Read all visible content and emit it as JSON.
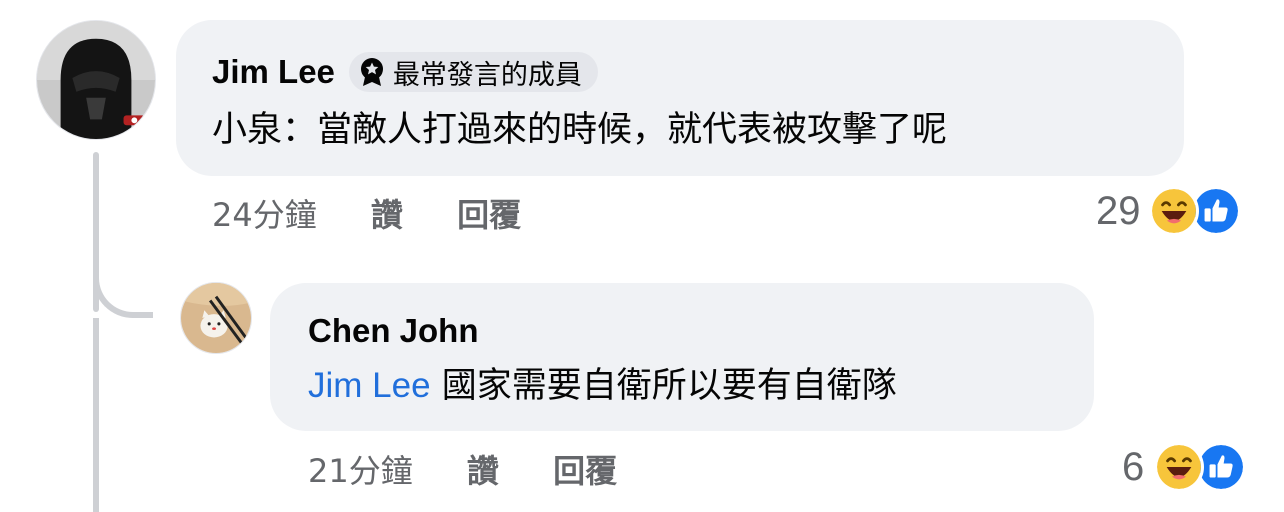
{
  "comments": [
    {
      "author": "Jim Lee",
      "badge": {
        "icon": "top-fan-medal-icon",
        "label": "最常發言的成員"
      },
      "text": "小泉：當敵人打過來的時候，就代表被攻擊了呢",
      "time": "24分鐘",
      "like_label": "讚",
      "reply_label": "回覆",
      "reaction_count": "29",
      "reactions": [
        "haha-icon",
        "like-icon"
      ],
      "avatar_icon": "helmet-avatar"
    },
    {
      "author": "Chen John",
      "mention": "Jim Lee",
      "text": "國家需要自衛所以要有自衛隊",
      "time": "21分鐘",
      "like_label": "讚",
      "reply_label": "回覆",
      "reaction_count": "6",
      "reactions": [
        "haha-icon",
        "like-icon"
      ],
      "avatar_icon": "cat-figurine-avatar"
    }
  ],
  "colors": {
    "bubble": "#f0f2f5",
    "meta": "#65676b",
    "mention": "#216fdb",
    "like_blue": "#1877f2",
    "haha_yellow": "#f7c53b"
  }
}
